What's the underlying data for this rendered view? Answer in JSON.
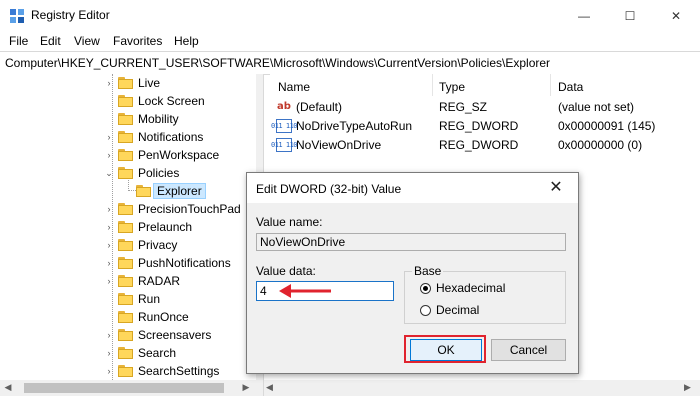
{
  "window": {
    "title": "Registry Editor",
    "controls": {
      "minimize": "—",
      "maximize": "☐",
      "close": "✕"
    }
  },
  "menu": [
    "File",
    "Edit",
    "View",
    "Favorites",
    "Help"
  ],
  "address": "Computer\\HKEY_CURRENT_USER\\SOFTWARE\\Microsoft\\Windows\\CurrentVersion\\Policies\\Explorer",
  "tree": {
    "items": [
      {
        "label": "Live",
        "expander": "›"
      },
      {
        "label": "Lock Screen",
        "expander": ""
      },
      {
        "label": "Mobility",
        "expander": ""
      },
      {
        "label": "Notifications",
        "expander": "›"
      },
      {
        "label": "PenWorkspace",
        "expander": "›"
      },
      {
        "label": "Policies",
        "expander": "⌄"
      },
      {
        "label": "Explorer",
        "expander": "",
        "selected": true
      },
      {
        "label": "PrecisionTouchPad",
        "expander": "›"
      },
      {
        "label": "Prelaunch",
        "expander": "›"
      },
      {
        "label": "Privacy",
        "expander": "›"
      },
      {
        "label": "PushNotifications",
        "expander": "›"
      },
      {
        "label": "RADAR",
        "expander": "›"
      },
      {
        "label": "Run",
        "expander": ""
      },
      {
        "label": "RunOnce",
        "expander": ""
      },
      {
        "label": "Screensavers",
        "expander": "›"
      },
      {
        "label": "Search",
        "expander": "›"
      },
      {
        "label": "SearchSettings",
        "expander": "›"
      }
    ],
    "scroll_left": "◀",
    "scroll_right": "▶"
  },
  "list": {
    "columns": [
      "Name",
      "Type",
      "Data"
    ],
    "rows": [
      {
        "icon": "ab",
        "name": "(Default)",
        "type": "REG_SZ",
        "data": "(value not set)"
      },
      {
        "icon": "011 110",
        "name": "NoDriveTypeAutoRun",
        "type": "REG_DWORD",
        "data": "0x00000091 (145)"
      },
      {
        "icon": "011 110",
        "name": "NoViewOnDrive",
        "type": "REG_DWORD",
        "data": "0x00000000 (0)"
      }
    ],
    "scroll_left": "◀",
    "scroll_right": "▶"
  },
  "dialog": {
    "title": "Edit DWORD (32-bit) Value",
    "close": "✕",
    "value_name_label": "Value name:",
    "value_name": "NoViewOnDrive",
    "value_data_label": "Value data:",
    "value_data": "4",
    "base_label": "Base",
    "radios": [
      {
        "label": "Hexadecimal",
        "checked": true
      },
      {
        "label": "Decimal",
        "checked": false
      }
    ],
    "ok": "OK",
    "cancel": "Cancel"
  },
  "colors": {
    "annotation_red": "#e0232e",
    "selection": "#cce8ff",
    "folder": "#ffd75b"
  }
}
